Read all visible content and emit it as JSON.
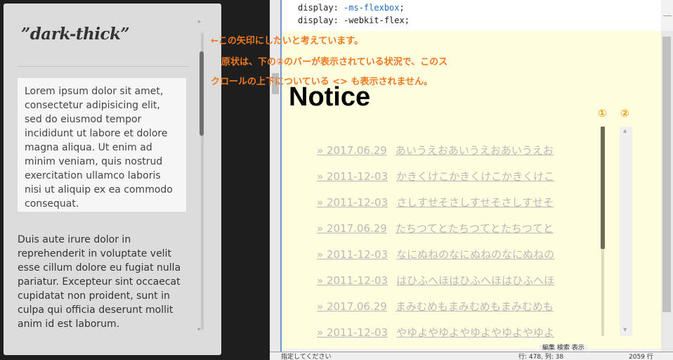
{
  "left_panel": {
    "title": "”dark-thick”",
    "boxed_paragraph": "Lorem ipsum dolor sit amet, consectetur adipisicing elit, sed do eiusmod tempor incididunt ut labore et dolore magna aliqua. Ut enim ad minim veniam, quis nostrud exercitation ullamco laboris nisi ut aliquip ex ea commodo consequat.",
    "paragraph": "Duis aute irure dolor in reprehenderit in voluptate velit esse cillum dolore eu fugiat nulla pariatur. Excepteur sint occaecat cupidatat non proident, sunt in culpa qui officia deserunt mollit anim id est laborum.",
    "scroll_up_icon": "˄",
    "scroll_down_icon": "˅"
  },
  "annotations": [
    "←この矢印にしたいと考えています。",
    "原状は、下の②のバーが表示されている状況で、このス",
    "クロールの上下についている <> も表示されません。"
  ],
  "code": {
    "line1_prop": "display: ",
    "line1_value": "-ms-flexbox",
    "line2": "display: -webkit-flex;"
  },
  "preview": {
    "heading": "Notice",
    "marker_1": "①",
    "marker_2": "②",
    "news": [
      {
        "date": "» 2017.06.29",
        "title": "あいうえおあいうえおあいうえお"
      },
      {
        "date": "» 2011-12-03",
        "title": "かきくけこかきくけこかきくけこ"
      },
      {
        "date": "» 2011-12-03",
        "title": "さしすせそさしすせそさしすせそ"
      },
      {
        "date": "» 2017.06.29",
        "title": "たちつてとたちつてとたちつてと"
      },
      {
        "date": "» 2011-12-03",
        "title": "なにぬねのなにぬねのなにぬねの"
      },
      {
        "date": "» 2011-12-03",
        "title": "はひふへほはひふへほはひふへほ"
      },
      {
        "date": "» 2017.06.29",
        "title": "まみむめもまみむめもまみむめも"
      },
      {
        "date": "» 2011-12-03",
        "title": "やゆよやゆよやゆよやゆよやゆよ"
      }
    ],
    "scroll_up_icon": "▲",
    "scroll_down_icon": "▼"
  },
  "status_bar": {
    "hint": "指定してください",
    "position": "行: 478, 列: 38",
    "size": "2059 行",
    "menu": "編集 検索 表示"
  },
  "colors": {
    "annotation": "#f07820",
    "marker": "#f0a020",
    "preview_bg": "#ffffe0",
    "panel_bg": "#dcdcdc"
  }
}
